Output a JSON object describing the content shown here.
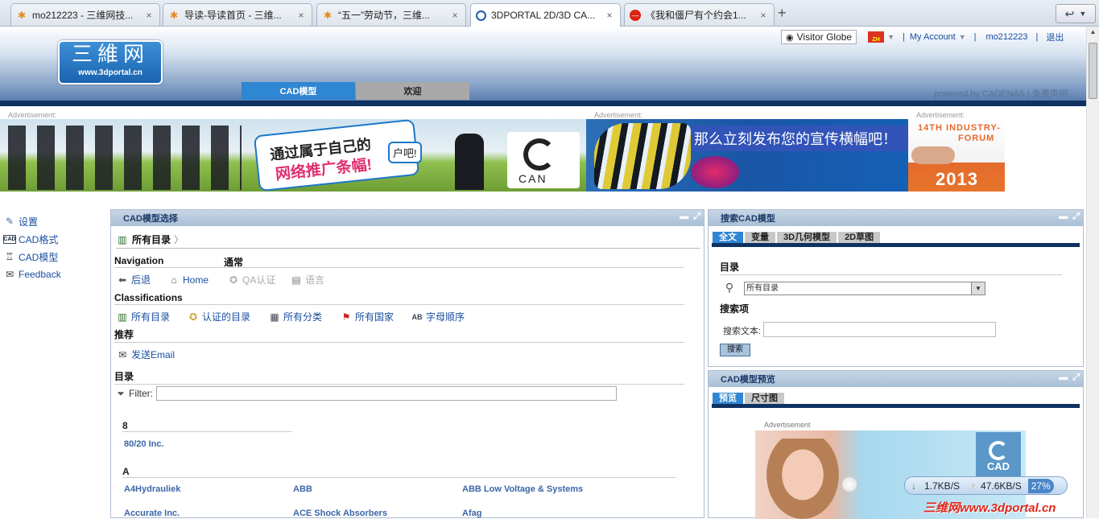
{
  "browser": {
    "tabs": [
      {
        "title": "mo212223 - 三维网技...",
        "icon": "asterisk-favicon-icon"
      },
      {
        "title": "导读-导读首页 - 三维...",
        "icon": "asterisk-favicon-icon"
      },
      {
        "title": "“五一”劳动节，三维...",
        "icon": "asterisk-favicon-icon"
      },
      {
        "title": "3DPORTAL 2D/3D CA...",
        "icon": "cadenas-favicon-icon"
      },
      {
        "title": "《我和僵尸有个约会1...",
        "icon": "red-favicon-icon"
      }
    ],
    "new_tab": "+",
    "close": "×"
  },
  "header": {
    "logo_main": "三維网",
    "logo_url": "www.3dportal.cn",
    "nav_tabs": [
      "CAD模型",
      "欢迎"
    ],
    "visitor_globe": "Visitor Globe",
    "lang": "ZH",
    "my_account": "My Account",
    "user": "mo212223",
    "logout": "退出",
    "powered_by": "powered by CADENAS | 免费声明"
  },
  "ads": {
    "label": "Advertisement:",
    "banner1_line1": "通过属于自己的",
    "banner1_line2": "网络推广条幅!",
    "banner1_tail": "户吧!",
    "banner1_brand": "CAN",
    "banner2_text": "那么立刻发布您的宣传横幅吧！",
    "banner3_line1": "14TH INDUSTRY-",
    "banner3_line2": "FORUM",
    "banner3_year": "2013"
  },
  "sidebar": {
    "items": [
      {
        "label": "设置",
        "icon": "pencil-icon"
      },
      {
        "label": "CAD格式",
        "icon": "cad-icon"
      },
      {
        "label": "CAD模型",
        "icon": "model-icon"
      },
      {
        "label": "Feedback",
        "icon": "envelope-icon"
      }
    ]
  },
  "cad_select": {
    "title": "CAD模型选择",
    "breadcrumb": "所有目录",
    "navigation_title": "Navigation",
    "general_title": "通常",
    "nav_links": [
      "后退",
      "Home",
      "QA认证",
      "语言"
    ],
    "classifications_title": "Classifications",
    "class_links": [
      "所有目录",
      "认证的目录",
      "所有分类",
      "所有国家",
      "字母顺序"
    ],
    "recommend_title": "推荐",
    "send_email": "发送Email",
    "catalog_title": "目录",
    "filter_label": "Filter:",
    "filter_value": "",
    "groups": [
      {
        "letter": "8",
        "items": [
          "80/20 Inc."
        ]
      },
      {
        "letter": "A",
        "items": [
          "A4Hydrauliek",
          "ABB",
          "ABB Low Voltage & Systems",
          "Accurate Inc.",
          "ACE Shock Absorbers",
          "Afag"
        ]
      }
    ]
  },
  "search_panel": {
    "title": "搜索CAD模型",
    "tabs": [
      "全文",
      "变量",
      "3D几何模型",
      "2D草图"
    ],
    "catalog_title": "目录",
    "catalog_value": "所有目录",
    "search_items_title": "搜索项",
    "search_text_label": "搜索文本:",
    "search_text_value": "",
    "search_button": "搜索"
  },
  "preview_panel": {
    "title": "CAD模型预览",
    "tabs": [
      "预览",
      "尺寸图"
    ],
    "ad_label": "Advertisement",
    "ad_brand": "CAD"
  },
  "speed_widget": {
    "down": "1.7KB/S",
    "up": "47.6KB/S",
    "percent": "27%"
  },
  "watermark": "三维网www.3dportal.cn"
}
